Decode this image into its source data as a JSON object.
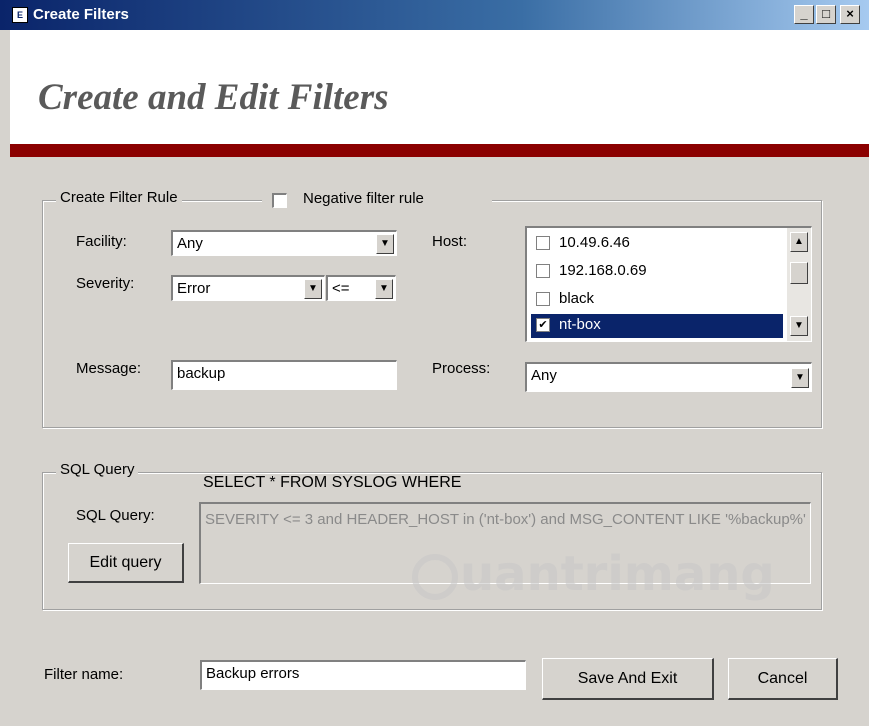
{
  "window": {
    "title": "Create Filters",
    "minimize": "_",
    "maximize": "□",
    "close": "×"
  },
  "header": {
    "heading": "Create and Edit Filters"
  },
  "filter_rule": {
    "legend": "Create Filter Rule",
    "negative_label": "Negative filter rule",
    "negative_checked": false,
    "facility_label": "Facility:",
    "facility_value": "Any",
    "severity_label": "Severity:",
    "severity_value": "Error",
    "operator_value": "<=",
    "message_label": "Message:",
    "message_value": "backup",
    "host_label": "Host:",
    "hosts": [
      {
        "label": "10.49.6.46",
        "checked": false,
        "check": ""
      },
      {
        "label": "192.168.0.69",
        "checked": false,
        "check": ""
      },
      {
        "label": "black",
        "checked": false,
        "check": ""
      },
      {
        "label": "nt-box",
        "checked": true,
        "check": "✔",
        "selected": true
      }
    ],
    "process_label": "Process:",
    "process_value": "Any"
  },
  "sql": {
    "legend": "SQL Query",
    "label": "SQL Query:",
    "prefix": "SELECT * FROM SYSLOG WHERE",
    "query": "SEVERITY <= 3 and HEADER_HOST in ('nt-box') and MSG_CONTENT LIKE '%backup%'",
    "edit_button": "Edit query"
  },
  "footer": {
    "filter_name_label": "Filter name:",
    "filter_name_value": "Backup errors",
    "save_button": "Save And Exit",
    "cancel_button": "Cancel"
  },
  "watermark": {
    "text": "uantrimang"
  },
  "icons": {
    "dropdown": "down-arrow-icon",
    "scroll_up": "scroll-up-icon",
    "scroll_down": "scroll-down-icon"
  }
}
